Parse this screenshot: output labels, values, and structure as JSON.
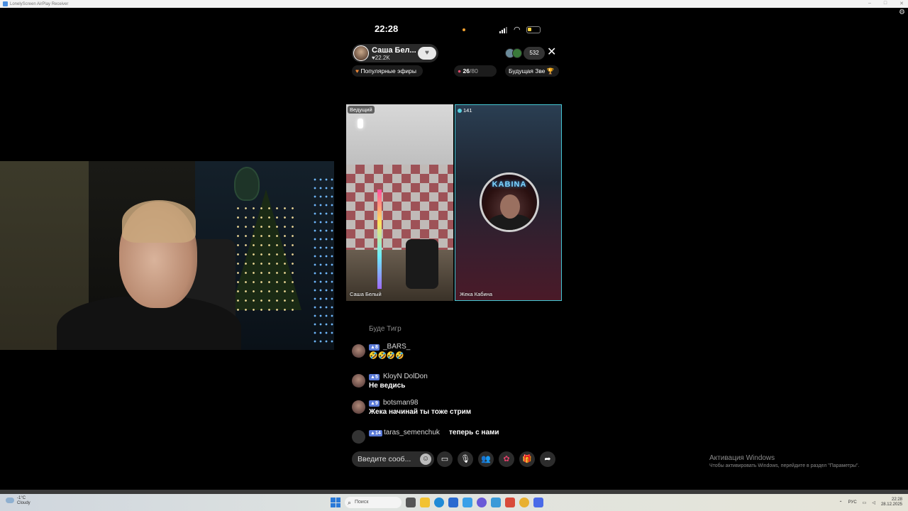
{
  "window": {
    "title": "LonelyScreen AirPlay Receiver"
  },
  "status_bar": {
    "time": "22:28"
  },
  "stream": {
    "host_name": "Саша Бел...",
    "host_likes": "♥22.2K",
    "viewer_count": "532",
    "popular_label": "Популярные эфиры",
    "score_value": "26",
    "score_total": "/80",
    "future_star_label": "Будущая Зве"
  },
  "tiles": {
    "host_tag": "Ведущий",
    "left_name": "Саша Белый",
    "right_count": "141",
    "right_name": "Жека Кабина",
    "guest_neon": "KABINA"
  },
  "chat": {
    "faded_line": "Буде Тигр",
    "messages": [
      {
        "level": "8",
        "user": "_BARS_",
        "text": "🤣🤣🤣🤣"
      },
      {
        "level": "5",
        "user": "KloyN DolDon",
        "text": "Не ведись"
      },
      {
        "level": "9",
        "user": "botsman98",
        "text": "Жека начинай ты тоже стрим"
      },
      {
        "level": "14",
        "user": "taras_semenchuk",
        "text": "теперь с нами"
      }
    ]
  },
  "input": {
    "placeholder": "Введите сооб..."
  },
  "activation": {
    "title": "Активация Windows",
    "subtitle": "Чтобы активировать Windows, перейдите в раздел \"Параметры\"."
  },
  "taskbar": {
    "weather_temp": "-1°C",
    "weather_desc": "Cloudy",
    "search_label": "Поиск",
    "lang": "РУС",
    "clock_time": "22:28",
    "clock_date": "28.12.2025"
  },
  "colors": {
    "accent_cyan": "#46c8d6",
    "badge_blue": "#5a7ad8",
    "windows_blue": "#2a7ad8"
  }
}
